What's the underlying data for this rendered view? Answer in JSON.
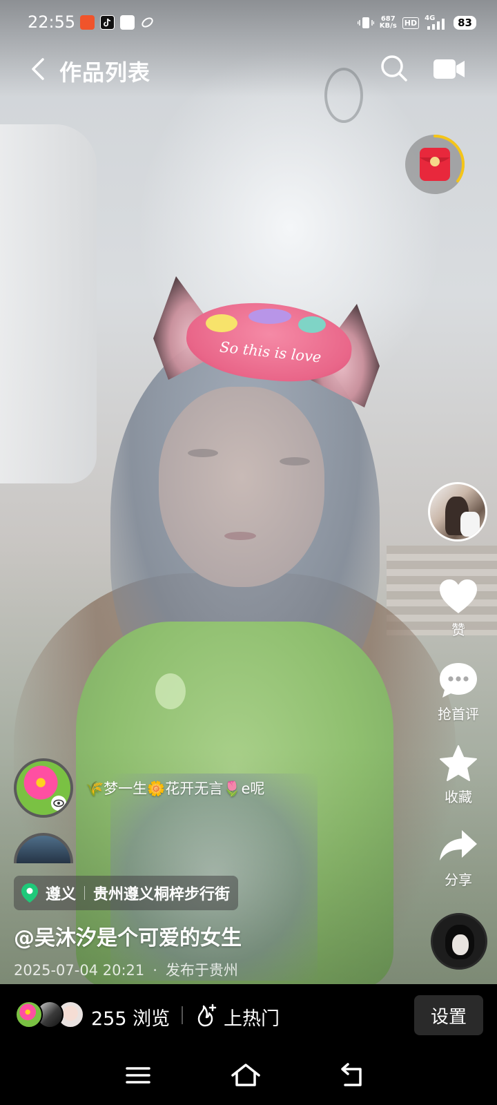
{
  "status_bar": {
    "time": "22:55",
    "net_speed_value": "687",
    "net_speed_unit": "KB/s",
    "hd": "HD",
    "signal": "4G",
    "battery": "83"
  },
  "header": {
    "title": "作品列表",
    "back_icon": "chevron-left-icon",
    "search_icon": "search-icon",
    "camera_icon": "video-camera-icon"
  },
  "red_packet": {
    "icon": "red-envelope-icon",
    "progress": 0.35,
    "ring_color": "#f5c518"
  },
  "actions": {
    "like_label": "赞",
    "comment_label": "抢首评",
    "favorite_label": "收藏",
    "share_label": "分享"
  },
  "comments": [
    {
      "text": "🌾梦一生🌼花开无言🌷e呢"
    },
    {
      "text": ""
    }
  ],
  "location": {
    "city": "遵义",
    "place": "贵州遵义桐梓步行街",
    "pin_color": "#1fc97a"
  },
  "description": "@吴沐汐是个可爱的女生",
  "meta": {
    "date": "2025-07-04 20:21",
    "dot": "·",
    "published": "发布于贵州"
  },
  "bottom_bar": {
    "views_count": "255",
    "views_label": "浏览",
    "hot_label": "上热门",
    "settings_label": "设置"
  },
  "video_text": "So this is love",
  "colors": {
    "accent_red": "#e8283c",
    "background": "#000000"
  }
}
